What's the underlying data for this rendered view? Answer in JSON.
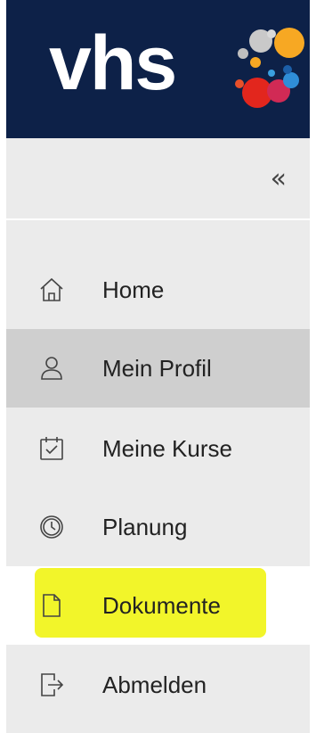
{
  "brand": {
    "logo_text": "vhs",
    "header_color": "#0d2148",
    "highlight_color": "#f2f52a"
  },
  "sidebar": {
    "collapse_icon": "double-chevron-left-icon",
    "collapse_glyph": "«",
    "items": [
      {
        "label": "Home",
        "icon": "home-icon"
      },
      {
        "label": "Mein Profil",
        "icon": "user-icon",
        "state": "hover"
      },
      {
        "label": "Meine Kurse",
        "icon": "calendar-check-icon"
      },
      {
        "label": "Planung",
        "icon": "clock-icon"
      },
      {
        "label": "Dokumente",
        "icon": "document-icon",
        "state": "highlighted"
      },
      {
        "label": "Abmelden",
        "icon": "logout-icon"
      }
    ]
  }
}
